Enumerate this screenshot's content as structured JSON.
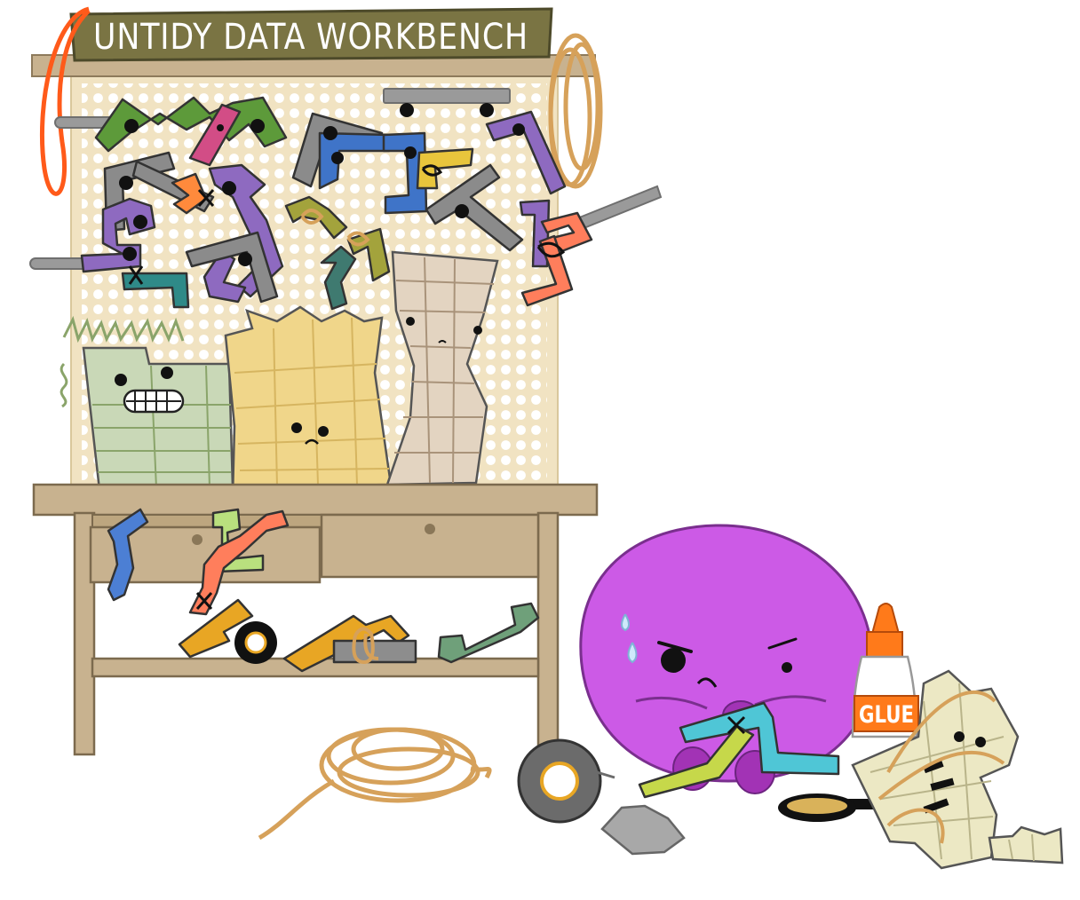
{
  "illustration": {
    "sign": {
      "title": "UNTIDY DATA WORKBENCH"
    },
    "glue_bottle": {
      "label": "GLUE"
    }
  },
  "colors": {
    "pegboard": "#f1e3c2",
    "peg_holes": "#ffffff",
    "bench_wood": "#c8b28f",
    "sign_board": "#7a7443",
    "monster": "#cc5ae6",
    "rope": "#d6a15a",
    "orange_cord": "#ff5a1a",
    "green_table": "#c9d8b7",
    "yellow_table": "#f0d68a",
    "tan_table": "#e3d4c1",
    "glue_orange": "#ff7a1a"
  },
  "icons": [
    "sweat-drop-icon",
    "frown-face-icon",
    "tape-roll-icon",
    "magnifying-glass-icon"
  ]
}
